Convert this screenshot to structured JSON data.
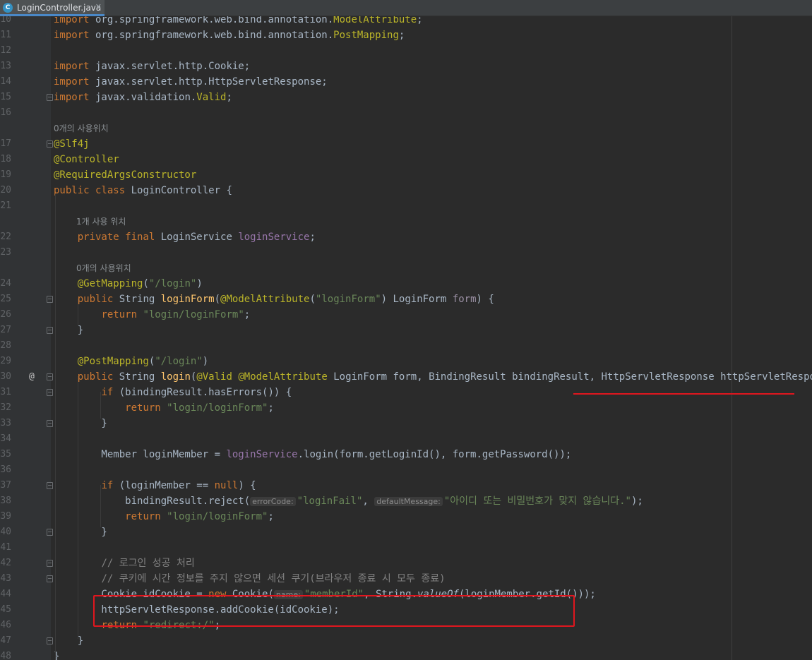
{
  "tab": {
    "title": "LoginController.java",
    "icon_letter": "C",
    "close": "✕"
  },
  "hints": {
    "usages_0": "0개의 사용위치",
    "usages_1": "1개 사용 위치",
    "usages_0b": "0개의 사용위치"
  },
  "gutter": {
    "override_marker": "@"
  },
  "lines": [
    {
      "n": "10",
      "text": "import org.springframework.web.bind.annotation.ModelAttribute;"
    },
    {
      "n": "11",
      "text": "import org.springframework.web.bind.annotation.PostMapping;"
    },
    {
      "n": "12",
      "text": ""
    },
    {
      "n": "13",
      "text": "import javax.servlet.http.Cookie;"
    },
    {
      "n": "14",
      "text": "import javax.servlet.http.HttpServletResponse;"
    },
    {
      "n": "15",
      "text": "import javax.validation.Valid;"
    },
    {
      "n": "16",
      "text": ""
    },
    {
      "n": "17",
      "text": "@Slf4j"
    },
    {
      "n": "18",
      "text": "@Controller"
    },
    {
      "n": "19",
      "text": "@RequiredArgsConstructor"
    },
    {
      "n": "20",
      "text": "public class LoginController {"
    },
    {
      "n": "21",
      "text": ""
    },
    {
      "n": "22",
      "text": "private final LoginService loginService;"
    },
    {
      "n": "23",
      "text": ""
    },
    {
      "n": "24",
      "text": "@GetMapping(\"/login\")"
    },
    {
      "n": "25",
      "text": "public String loginForm(@ModelAttribute(\"loginForm\") LoginForm form) {"
    },
    {
      "n": "26",
      "text": "return \"login/loginForm\";"
    },
    {
      "n": "27",
      "text": "}"
    },
    {
      "n": "28",
      "text": ""
    },
    {
      "n": "29",
      "text": "@PostMapping(\"/login\")"
    },
    {
      "n": "30",
      "text": "public String login(@Valid @ModelAttribute LoginForm form, BindingResult bindingResult, HttpServletResponse httpServletResponse) {"
    },
    {
      "n": "31",
      "text": "if (bindingResult.hasErrors()) {"
    },
    {
      "n": "32",
      "text": "return \"login/loginForm\";"
    },
    {
      "n": "33",
      "text": "}"
    },
    {
      "n": "34",
      "text": ""
    },
    {
      "n": "35",
      "text": "Member loginMember = loginService.login(form.getLoginId(), form.getPassword());"
    },
    {
      "n": "36",
      "text": ""
    },
    {
      "n": "37",
      "text": "if (loginMember == null) {"
    },
    {
      "n": "38",
      "text": "bindingResult.reject( errorCode: \"loginFail\",  defaultMessage: \"아이디 또는 비밀번호가 맞지 않습니다.\");"
    },
    {
      "n": "39",
      "text": "return \"login/loginForm\";"
    },
    {
      "n": "40",
      "text": "}"
    },
    {
      "n": "41",
      "text": ""
    },
    {
      "n": "42",
      "text": "// 로그인 성공 처리"
    },
    {
      "n": "43",
      "text": "// 쿠키에 시간 정보를 주지 않으면 세션 쿠기(브라우저 종료 시 모두 종료)"
    },
    {
      "n": "44",
      "text": "Cookie idCookie = new Cookie( name: \"memberId\", String.valueOf(loginMember.getId()));"
    },
    {
      "n": "45",
      "text": "httpServletResponse.addCookie(idCookie);"
    },
    {
      "n": "46",
      "text": "return \"redirect:/\";"
    },
    {
      "n": "47",
      "text": "}"
    },
    {
      "n": "48",
      "text": "}"
    }
  ],
  "colors": {
    "background": "#2b2b2b",
    "keyword": "#cc7832",
    "annotation": "#bbb529",
    "string": "#6a8759",
    "field": "#9876aa",
    "method_decl": "#ffc66d",
    "highlight": "#e0161e"
  }
}
